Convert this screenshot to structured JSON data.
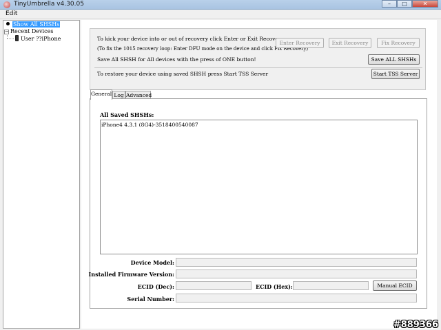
{
  "window": {
    "title": "TinyUmbrella v4.30.05",
    "app_icon": "umbrella-icon",
    "controls": {
      "minimize": "–",
      "maximize": "□",
      "close": "✕"
    }
  },
  "menu": {
    "items": [
      "Edit"
    ]
  },
  "tree": {
    "items": [
      {
        "label": "Show All SHSHs",
        "icon": "bullet-icon",
        "selected": true
      },
      {
        "label": "Recent Devices",
        "icon": "expand-icon",
        "expander": "−"
      },
      {
        "label": "User ??iPhone",
        "icon": "iphone-icon"
      }
    ]
  },
  "recovery": {
    "line1": "To kick your device into or out of recovery click Enter or Exit Recovery",
    "line2": "(To fix the 1015 recovery loop: Enter DFU mode on the device and click Fix Recovery)",
    "line3": "Save All SHSH for All devices with the press of ONE button!",
    "line4": "To restore your device using saved SHSH press Start TSS Server",
    "enter_label": "Enter Recovery",
    "exit_label": "Exit Recovery",
    "fix_label": "Fix Recovery",
    "save_all_label": "Save ALL SHSHs",
    "start_tss_label": "Start TSS Server"
  },
  "tabs": [
    "General",
    "Log",
    "Advanced"
  ],
  "general": {
    "list_label": "All Saved SHSHs:",
    "shsh_items": [
      "iPhone4 4.3.1 (8G4)-3518400540087"
    ],
    "device_model_label": "Device Model:",
    "installed_firmware_label": "Installed Firmware Version:",
    "ecid_dec_label": "ECID (Dec):",
    "ecid_hex_label": "ECID (Hex):",
    "manual_ecid_label": "Manual ECID",
    "serial_label": "Serial Number:",
    "device_model_value": "",
    "installed_firmware_value": "",
    "ecid_dec_value": "",
    "ecid_hex_value": "",
    "serial_value": ""
  },
  "watermark": "#889366"
}
